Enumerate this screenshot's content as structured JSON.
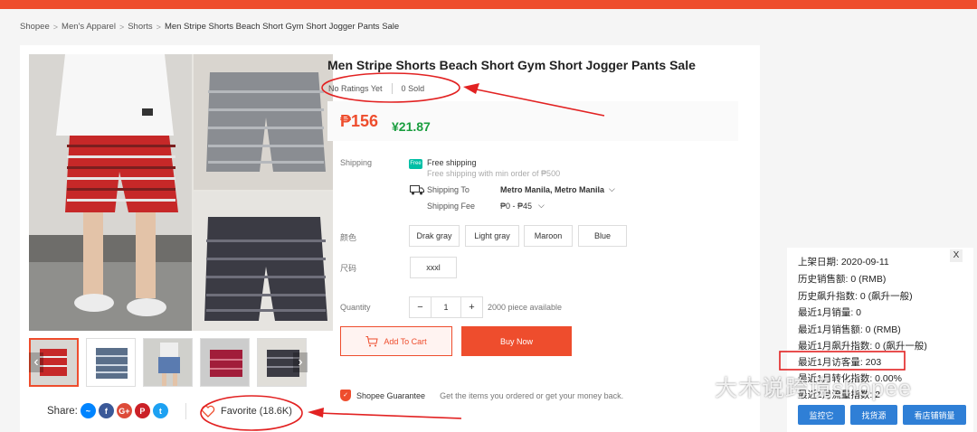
{
  "breadcrumb": [
    "Shopee",
    "Men's Apparel",
    "Shorts",
    "Men Stripe Shorts Beach Short Gym Short Jogger Pants Sale"
  ],
  "product": {
    "title": "Men Stripe Shorts Beach Short Gym Short Jogger Pants Sale",
    "ratings": "No Ratings Yet",
    "sold_count": "0",
    "sold_label": "Sold",
    "price": "₱156",
    "price_cny": "¥21.87"
  },
  "shipping": {
    "label": "Shipping",
    "free_badge": "Free",
    "free_title": "Free shipping",
    "free_sub": "Free shipping with min order of ₱500",
    "to_label": "Shipping To",
    "to_value": "Metro Manila, Metro Manila",
    "fee_label": "Shipping Fee",
    "fee_value": "₱0 - ₱45"
  },
  "variations": {
    "color_label": "颜色",
    "colors": [
      "Drak gray",
      "Light gray",
      "Maroon",
      "Blue"
    ],
    "size_label": "尺码",
    "sizes": [
      "xxxl"
    ]
  },
  "quantity": {
    "label": "Quantity",
    "value": "1",
    "available": "2000 piece available"
  },
  "actions": {
    "add_to_cart": "Add To Cart",
    "buy_now": "Buy Now"
  },
  "guarantee": {
    "title": "Shopee Guarantee",
    "desc": "Get the items you ordered or get your money back."
  },
  "share": {
    "label": "Share:",
    "icons": [
      "messenger-icon",
      "facebook-icon",
      "google-plus-icon",
      "pinterest-icon",
      "twitter-icon"
    ]
  },
  "favorite": "Favorite (18.6K)",
  "stats_panel": {
    "close": "X",
    "lines": [
      "上架日期: 2020-09-11",
      "历史销售额: 0 (RMB)",
      "历史飙升指数: 0 (飙升一般)",
      "最近1月销量: 0",
      "最近1月销售额: 0 (RMB)",
      "最近1月飙升指数: 0 (飙升一般)",
      "最近1月访客量: 203",
      "最近1月转化指数: 0.00%",
      "最近1月流量指数: 2"
    ],
    "buttons": [
      "监控它",
      "找货源",
      "看店铺销量"
    ]
  },
  "watermark": "大木说跨境shopee",
  "colors": {
    "brand": "#ee4d2d",
    "cny_green": "#1a9e3f",
    "annotation_red": "#e22222",
    "panel_button": "#2f7fd6"
  }
}
